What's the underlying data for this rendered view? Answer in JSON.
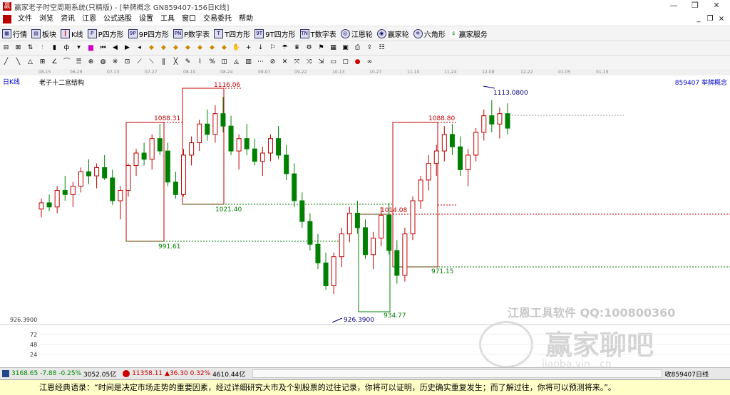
{
  "window": {
    "title": "赢家老子时空周期系统(只精版) - [举牌概念  GN859407-156日K线]",
    "minimize": "—",
    "restore": "❐",
    "close": "✕"
  },
  "menu": {
    "items": [
      "文件",
      "浏览",
      "资讯",
      "江恩",
      "公式选股",
      "设置",
      "工具",
      "窗口",
      "交易委托",
      "帮助"
    ],
    "mdi": [
      "_",
      "❐",
      "×"
    ]
  },
  "toolbar": {
    "items": [
      {
        "icon": "grid-icon",
        "label": "行情"
      },
      {
        "icon": "blocks-icon",
        "label": "板块"
      },
      {
        "icon": "candle-icon",
        "label": "K线"
      },
      {
        "icon": "p-square-icon",
        "label": "P四方形"
      },
      {
        "icon": "9p-square-icon",
        "label": "9P四方形"
      },
      {
        "icon": "p-number-icon",
        "label": "P数字表"
      },
      {
        "icon": "t-square-icon",
        "label": "T四方形"
      },
      {
        "icon": "9t-square-icon",
        "label": "9T四方形"
      },
      {
        "icon": "t-number-icon",
        "label": "T数字表"
      },
      {
        "icon": "gann-wheel-icon",
        "label": "江恩轮"
      },
      {
        "icon": "winner-wheel-icon",
        "label": "赢家轮"
      },
      {
        "icon": "hexagon-icon",
        "label": "六角形"
      },
      {
        "icon": "service-icon",
        "label": "赢家服务"
      }
    ]
  },
  "date_ticks": [
    "08-15",
    "06-29",
    "07-13",
    "07-27",
    "08-10",
    "08-24",
    "09-07",
    "09-22",
    "10-13",
    "10-27",
    "11-10",
    "11-24",
    "12-08",
    "12-22",
    "01-05",
    "01-19"
  ],
  "chart": {
    "sidetab": "日K线",
    "title": "老子十二宫结构",
    "code": "859407  举牌概念",
    "labels": [
      {
        "text": "1116.06",
        "color": "#c00000"
      },
      {
        "text": "1088.31",
        "color": "#c00000"
      },
      {
        "text": "1088.80",
        "color": "#c00000"
      },
      {
        "text": "1113.0800",
        "color": "#000080"
      },
      {
        "text": "1021.40",
        "color": "#008000"
      },
      {
        "text": "1014.08",
        "color": "#c00000"
      },
      {
        "text": "991.61",
        "color": "#008000"
      },
      {
        "text": "971.15",
        "color": "#008000"
      },
      {
        "text": "934.77",
        "color": "#008000"
      },
      {
        "text": "926.3900",
        "color": "#000080"
      }
    ],
    "y_axis": [
      "926.3900",
      "72",
      "48",
      "24"
    ]
  },
  "watermark": {
    "line1": "江恩工具软件  QQ:100800360",
    "line2": "赢家聊吧",
    "line3": "jiaoba.yin...cn"
  },
  "status": {
    "sh": {
      "value": "3168.65",
      "change": "-7.88",
      "pct": "-0.25%",
      "amount": "3052.05亿"
    },
    "sz": {
      "value": "11358.11",
      "change": "▲36.30",
      "pct": "0.32%",
      "amount": "4610.44亿"
    },
    "right": "收859407日线"
  },
  "quote": "江恩经典语录：“时间是决定市场走势的重要因素，经过详细研究大市及个别股票的过往记录，你将可以证明，历史确实重复发生；而了解过往，你将可以预测将来。”。",
  "colors": {
    "up": "#c00000",
    "down": "#008000",
    "box_red": "#c00000",
    "box_green": "#008000"
  },
  "chart_data": {
    "type": "candlestick",
    "name": "举牌概念 GN859407 日K线",
    "ohlc": [
      [
        1008,
        1018,
        1000,
        1014
      ],
      [
        1014,
        1022,
        1006,
        1010
      ],
      [
        1010,
        1030,
        1004,
        1026
      ],
      [
        1026,
        1040,
        1016,
        1022
      ],
      [
        1022,
        1034,
        1010,
        1030
      ],
      [
        1030,
        1048,
        1024,
        1044
      ],
      [
        1044,
        1056,
        1032,
        1040
      ],
      [
        1040,
        1052,
        1028,
        1048
      ],
      [
        1048,
        1060,
        1036,
        1038
      ],
      [
        1038,
        1046,
        1012,
        1016
      ],
      [
        1016,
        1030,
        998,
        1026
      ],
      [
        1026,
        1052,
        1020,
        1050
      ],
      [
        1050,
        1066,
        1040,
        1062
      ],
      [
        1062,
        1072,
        1050,
        1056
      ],
      [
        1056,
        1080,
        1046,
        1076
      ],
      [
        1076,
        1090,
        1060,
        1064
      ],
      [
        1064,
        1072,
        1030,
        1034
      ],
      [
        1034,
        1044,
        1018,
        1022
      ],
      [
        1022,
        1066,
        1020,
        1060
      ],
      [
        1060,
        1078,
        1050,
        1072
      ],
      [
        1072,
        1094,
        1064,
        1090
      ],
      [
        1090,
        1104,
        1074,
        1080
      ],
      [
        1080,
        1108,
        1072,
        1100
      ],
      [
        1100,
        1116,
        1082,
        1088
      ],
      [
        1088,
        1098,
        1060,
        1064
      ],
      [
        1064,
        1080,
        1046,
        1076
      ],
      [
        1076,
        1090,
        1060,
        1066
      ],
      [
        1066,
        1076,
        1050,
        1054
      ],
      [
        1054,
        1068,
        1040,
        1062
      ],
      [
        1062,
        1080,
        1054,
        1076
      ],
      [
        1076,
        1088,
        1056,
        1060
      ],
      [
        1060,
        1070,
        1036,
        1042
      ],
      [
        1042,
        1052,
        1010,
        1016
      ],
      [
        1016,
        1024,
        990,
        996
      ],
      [
        996,
        1004,
        968,
        974
      ],
      [
        974,
        984,
        950,
        956
      ],
      [
        956,
        966,
        930,
        934
      ],
      [
        934,
        966,
        926,
        962
      ],
      [
        962,
        990,
        952,
        984
      ],
      [
        984,
        1010,
        976,
        1004
      ],
      [
        1004,
        1016,
        984,
        990
      ],
      [
        990,
        998,
        960,
        964
      ],
      [
        964,
        986,
        950,
        980
      ],
      [
        980,
        1010,
        972,
        1002
      ],
      [
        1002,
        1014,
        964,
        968
      ],
      [
        968,
        978,
        936,
        944
      ],
      [
        944,
        990,
        938,
        984
      ],
      [
        984,
        1020,
        978,
        1016
      ],
      [
        1016,
        1040,
        1008,
        1036
      ],
      [
        1036,
        1060,
        1026,
        1052
      ],
      [
        1052,
        1070,
        1040,
        1064
      ],
      [
        1064,
        1088,
        1054,
        1080
      ],
      [
        1080,
        1090,
        1060,
        1068
      ],
      [
        1068,
        1078,
        1040,
        1046
      ],
      [
        1046,
        1066,
        1030,
        1060
      ],
      [
        1060,
        1086,
        1054,
        1082
      ],
      [
        1082,
        1104,
        1074,
        1098
      ],
      [
        1098,
        1113,
        1082,
        1090
      ],
      [
        1090,
        1106,
        1076,
        1100
      ],
      [
        1100,
        1110,
        1080,
        1086
      ]
    ],
    "levels": {
      "box_high_1": 1088.31,
      "box_low_1": 991.61,
      "box_high_2": 1116.06,
      "box_low_2": 1021.4,
      "box_high_3": 1088.8,
      "box_low_3": 971.15,
      "box_low_4": 934.77,
      "box_high_4": 1014.08,
      "low": 926.39,
      "high": 1113.08
    },
    "y_range": [
      900,
      1130
    ]
  }
}
